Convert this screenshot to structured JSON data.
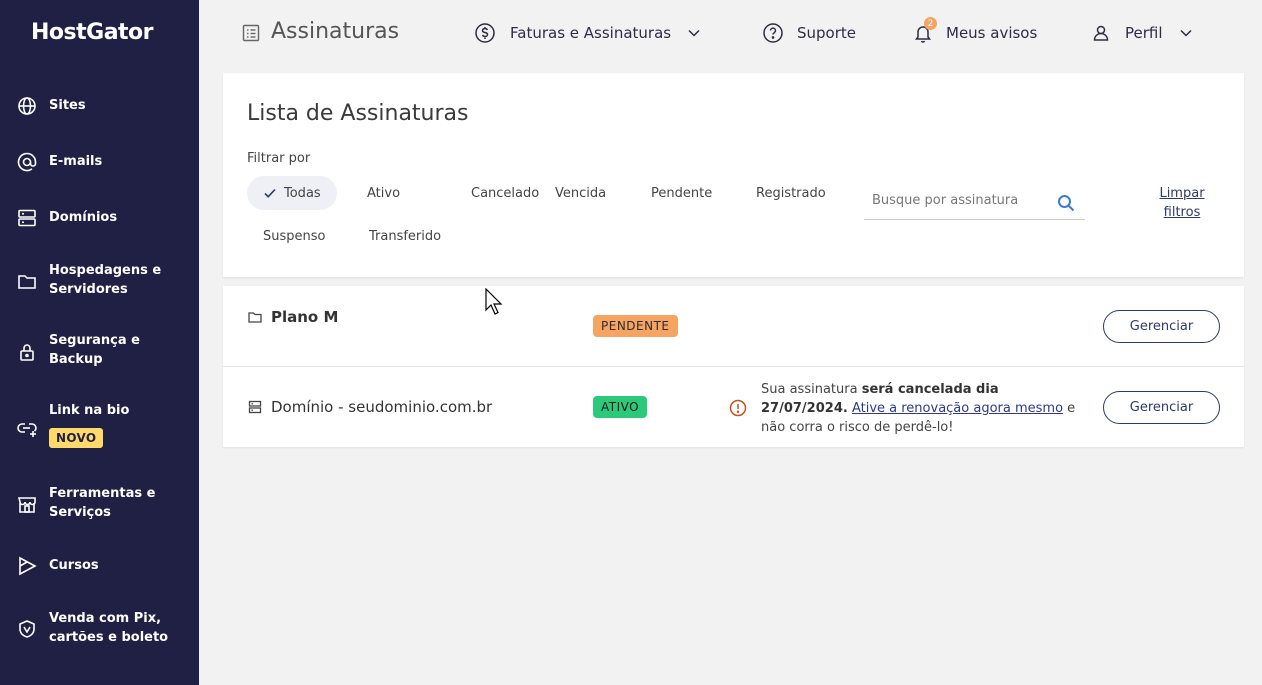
{
  "sidebar": {
    "logo": "HostGator",
    "items": [
      {
        "label": "Sites",
        "icon": "globe-icon"
      },
      {
        "label": "E-mails",
        "icon": "at-icon"
      },
      {
        "label": "Domínios",
        "icon": "server-icon"
      },
      {
        "label": "Hospedagens e Servidores",
        "icon": "folder-icon"
      },
      {
        "label": "Segurança e Backup",
        "icon": "lock-icon"
      },
      {
        "label": "Link na bio",
        "icon": "link-icon",
        "badge": "NOVO"
      },
      {
        "label": "Ferramentas e Serviços",
        "icon": "store-icon"
      },
      {
        "label": "Cursos",
        "icon": "play-icon"
      },
      {
        "label": "Venda com Pix, cartões e boleto",
        "icon": "shield-icon"
      }
    ]
  },
  "topbar": {
    "title": "Assinaturas",
    "billing": "Faturas e Assinaturas",
    "support": "Suporte",
    "notifications": "Meus avisos",
    "notification_count": "2",
    "profile": "Perfil"
  },
  "filters": {
    "title": "Lista de Assinaturas",
    "filter_label": "Filtrar por",
    "chips": [
      "Todas",
      "Ativo",
      "Cancelado",
      "Vencida",
      "Pendente",
      "Registrado",
      "Suspenso",
      "Transferido"
    ],
    "active_chip": "Todas",
    "search_placeholder": "Busque por assinatura",
    "clear": "Limpar filtros"
  },
  "subscriptions": [
    {
      "name": "Plano M",
      "icon": "folder-icon",
      "status": "PENDENTE",
      "status_color": "#f5a462",
      "action": "Gerenciar"
    },
    {
      "name": "Domínio - seudominio.com.br",
      "icon": "server-icon",
      "status": "ATIVO",
      "status_color": "#2dc97a",
      "notice_prefix": "Sua assinatura ",
      "notice_bold": "será cancelada dia 27/07/2024.",
      "notice_link": "Ative a renovação agora mesmo",
      "notice_suffix": " e não corra o risco de perdê-lo!",
      "action": "Gerenciar"
    }
  ],
  "colors": {
    "sidebar_bg": "#1f2044",
    "accent": "#2d3a6b",
    "pending": "#f5a462",
    "active": "#2dc97a",
    "badge": "#ffd96a"
  }
}
